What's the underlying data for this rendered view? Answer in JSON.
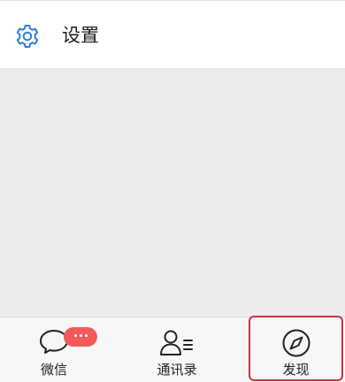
{
  "settings": {
    "label": "设置",
    "icon": "gear-icon"
  },
  "tabbar": {
    "tabs": [
      {
        "label": "微信",
        "icon": "chat-bubble-icon",
        "badge": "more-dots",
        "selected": false
      },
      {
        "label": "通讯录",
        "icon": "contacts-icon",
        "selected": false
      },
      {
        "label": "发现",
        "icon": "compass-icon",
        "selected": false,
        "highlighted": true
      }
    ]
  },
  "colors": {
    "accent": "#2d7ed6",
    "badge": "#f15b5b",
    "highlight": "#c7353c",
    "background": "#ededed"
  }
}
